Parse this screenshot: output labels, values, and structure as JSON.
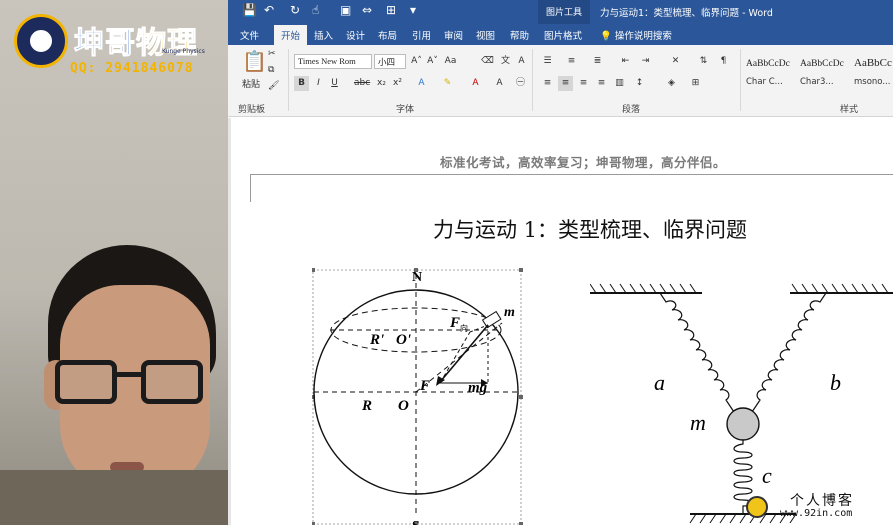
{
  "logo": {
    "title_a": "坤哥",
    "title_b": "物理",
    "subtitle": "Kunge Physics",
    "qq": "QQ: 2941846078"
  },
  "word": {
    "context_tab": "图片工具",
    "window_title": "力与运动1：类型梳理、临界问题 - Word",
    "tabs": [
      "文件",
      "开始",
      "插入",
      "设计",
      "布局",
      "引用",
      "审阅",
      "视图",
      "帮助",
      "图片格式"
    ],
    "active_tab": "开始",
    "tell_me": "操作说明搜索",
    "ribbon": {
      "paste_label": "粘贴",
      "clipboard_label": "剪贴板",
      "font_label": "字体",
      "paragraph_label": "段落",
      "styles_label": "样式",
      "font_name": "Times New Rom",
      "font_size": "小四",
      "styles": [
        {
          "sample": "AaBbCcDc",
          "name": "Char C..."
        },
        {
          "sample": "AaBbCcDc",
          "name": "Char3..."
        },
        {
          "sample": "AaBbCc",
          "name": "msono..."
        }
      ]
    }
  },
  "document": {
    "header": "标准化考试，高效率复习；坤哥物理，高分伴侣。",
    "heading": "力与运动 1：类型梳理、临界问题",
    "figure1": {
      "north": "N",
      "south": "S",
      "r_prime": "R'",
      "o_prime": "O'",
      "r": "R",
      "o": "O",
      "f": "F",
      "f_sub": "向",
      "mg": "mg",
      "m": "m"
    },
    "figure2": {
      "a": "a",
      "b": "b",
      "c": "c",
      "m": "m"
    }
  },
  "watermark": {
    "title": "个人博客",
    "url": "www.92in.com"
  },
  "colors": {
    "word_blue": "#2b579a",
    "ribbon_bg": "#f3f3f3",
    "logo_blue": "#1d64c8",
    "logo_gold": "#f2b400"
  }
}
